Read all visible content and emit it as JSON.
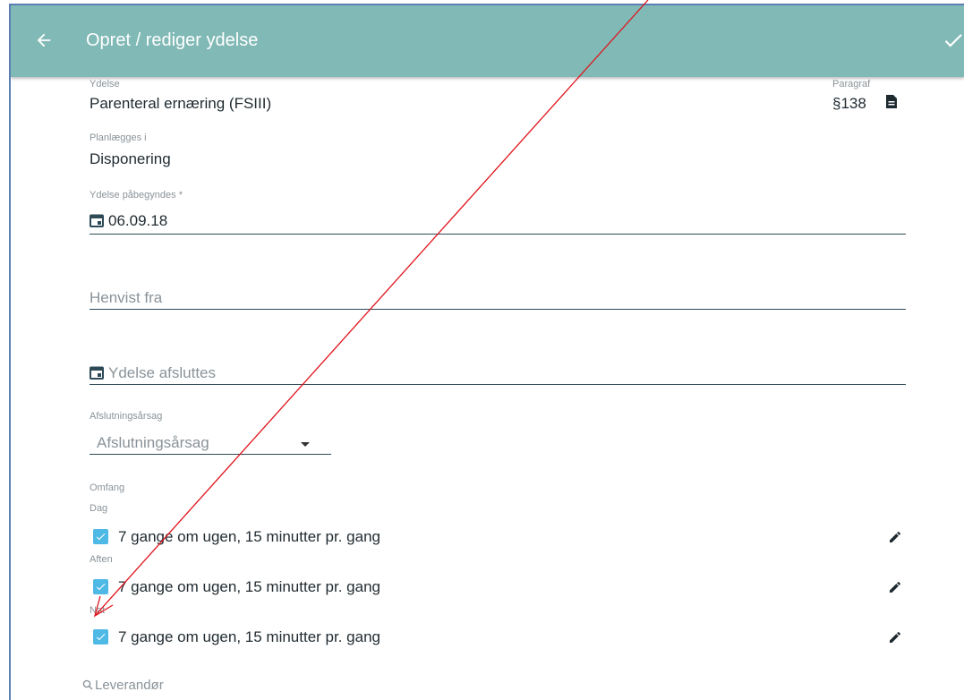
{
  "header": {
    "title": "Opret / rediger ydelse"
  },
  "form": {
    "ydelse": {
      "label": "Ydelse",
      "value": "Parenteral ernæring (FSIII)"
    },
    "paragraf": {
      "label": "Paragraf",
      "value": "§138"
    },
    "planlaegges": {
      "label": "Planlægges i",
      "value": "Disponering"
    },
    "start": {
      "label": "Ydelse påbegyndes *",
      "value": "06.09.18"
    },
    "henvist": {
      "placeholder": "Henvist fra"
    },
    "slut": {
      "placeholder": "Ydelse afsluttes"
    },
    "afslutning": {
      "label": "Afslutningsårsag",
      "placeholder": "Afslutningsårsag"
    },
    "omfang": {
      "label": "Omfang",
      "items": [
        {
          "period": "Dag",
          "text": "7 gange om ugen, 15 minutter pr. gang",
          "checked": true
        },
        {
          "period": "Aften",
          "text": "7 gange om ugen, 15 minutter pr. gang",
          "checked": true
        },
        {
          "period": "Nat",
          "text": "7 gange om ugen, 15 minutter pr. gang",
          "checked": true
        }
      ]
    },
    "leverandor": {
      "placeholder": "Leverandør"
    }
  },
  "colors": {
    "toolbar": "#80b9b5",
    "checkbox": "#4fb9e6",
    "annotation_arrow": "#e0141c"
  },
  "icons": [
    "back-arrow-icon",
    "check-icon",
    "document-icon",
    "calendar-icon",
    "dropdown-arrow-icon",
    "checkbox-checked-icon",
    "pencil-icon",
    "search-icon"
  ]
}
